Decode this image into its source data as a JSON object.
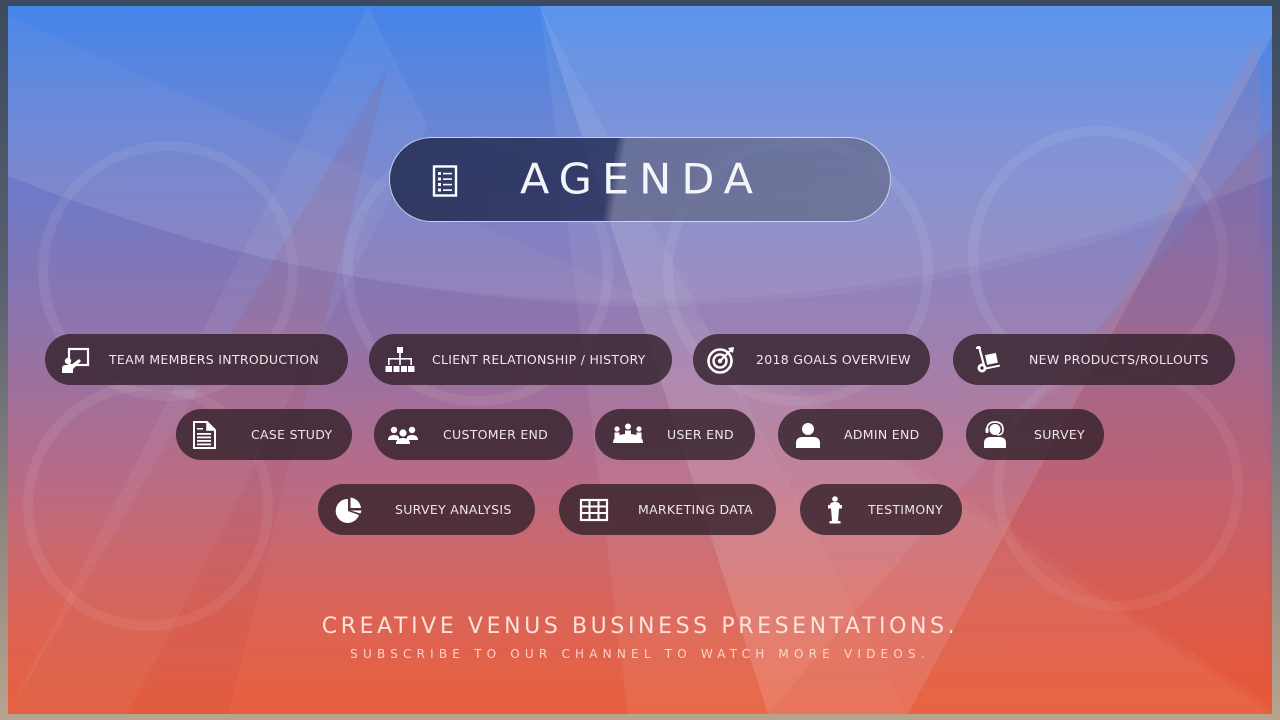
{
  "slide": {
    "title": "AGENDA",
    "title_icon": "list-document-icon",
    "colors": {
      "top": "#2f78e8",
      "middle": "#8a6faa",
      "bottom": "#e85a36",
      "pill_background": "#34222c",
      "text": "#ffffff"
    }
  },
  "agenda_items": [
    {
      "label": "TEAM MEMBERS INTRODUCTION",
      "icon": "presentation-board-icon"
    },
    {
      "label": "CLIENT RELATIONSHIP / HISTORY",
      "icon": "org-chart-icon"
    },
    {
      "label": "2018 GOALS OVERVIEW",
      "icon": "target-icon"
    },
    {
      "label": "NEW PRODUCTS/ROLLOUTS",
      "icon": "hand-truck-icon"
    },
    {
      "label": "CASE STUDY",
      "icon": "document-icon"
    },
    {
      "label": "CUSTOMER END",
      "icon": "group-icon"
    },
    {
      "label": "USER END",
      "icon": "meeting-table-icon"
    },
    {
      "label": "ADMIN END",
      "icon": "user-icon"
    },
    {
      "label": "SURVEY",
      "icon": "headset-user-icon"
    },
    {
      "label": "SURVEY ANALYSIS",
      "icon": "pie-chart-icon"
    },
    {
      "label": "MARKETING DATA",
      "icon": "table-grid-icon"
    },
    {
      "label": "TESTIMONY",
      "icon": "podium-speaker-icon"
    }
  ],
  "footer": {
    "title": "CREATIVE VENUS BUSINESS PRESENTATIONS.",
    "subtitle": "SUBSCRIBE TO OUR CHANNEL TO WATCH MORE VIDEOS."
  }
}
